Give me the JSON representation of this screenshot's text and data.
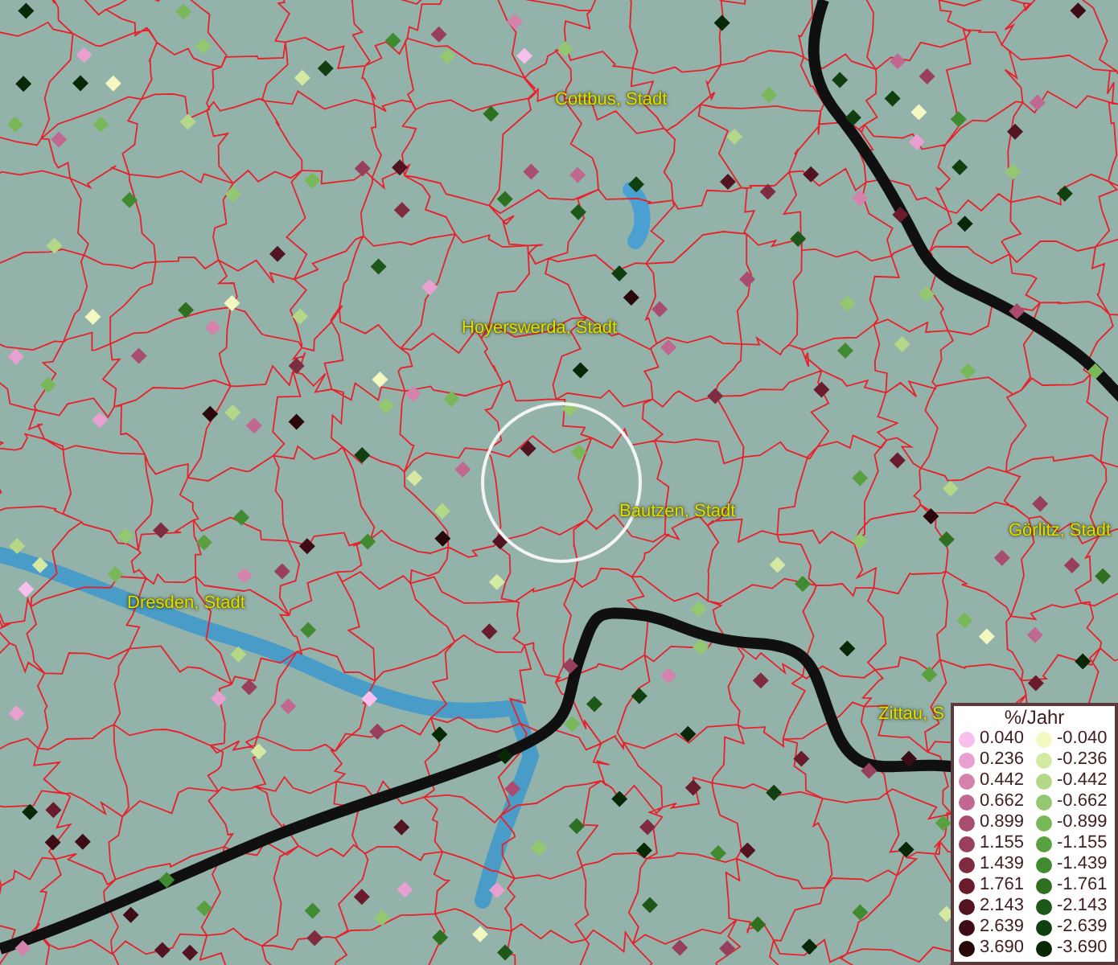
{
  "map": {
    "place_labels": [
      {
        "text": "Cottbus, Stadt"
      },
      {
        "text": "Hoyerswerda, Stadt"
      },
      {
        "text": "Bautzen, Stadt"
      },
      {
        "text": "Görlitz, Stadt"
      },
      {
        "text": "Dresden, Stadt"
      },
      {
        "text": "Zittau, S"
      }
    ]
  },
  "legend": {
    "title": "%/Jahr",
    "positive": [
      {
        "label": "0.040",
        "color": "#f8c0ec"
      },
      {
        "label": "0.236",
        "color": "#e8a0d0"
      },
      {
        "label": "0.442",
        "color": "#d484ac"
      },
      {
        "label": "0.662",
        "color": "#c06890"
      },
      {
        "label": "0.899",
        "color": "#a84c70"
      },
      {
        "label": "1.155",
        "color": "#983f5c"
      },
      {
        "label": "1.439",
        "color": "#802c40"
      },
      {
        "label": "1.761",
        "color": "#681c2c"
      },
      {
        "label": "2.143",
        "color": "#521420"
      },
      {
        "label": "2.639",
        "color": "#3e0c14"
      },
      {
        "label": "3.690",
        "color": "#280808"
      }
    ],
    "negative": [
      {
        "label": "-0.040",
        "color": "#f2f8c0"
      },
      {
        "label": "-0.236",
        "color": "#d4eaa2"
      },
      {
        "label": "-0.442",
        "color": "#b4d888"
      },
      {
        "label": "-0.662",
        "color": "#94c870"
      },
      {
        "label": "-0.899",
        "color": "#78b858"
      },
      {
        "label": "-1.155",
        "color": "#5aa040"
      },
      {
        "label": "-1.439",
        "color": "#408a30"
      },
      {
        "label": "-1.761",
        "color": "#2e7020"
      },
      {
        "label": "-2.143",
        "color": "#1e5818"
      },
      {
        "label": "-2.639",
        "color": "#104010"
      },
      {
        "label": "-3.690",
        "color": "#082808"
      }
    ]
  }
}
